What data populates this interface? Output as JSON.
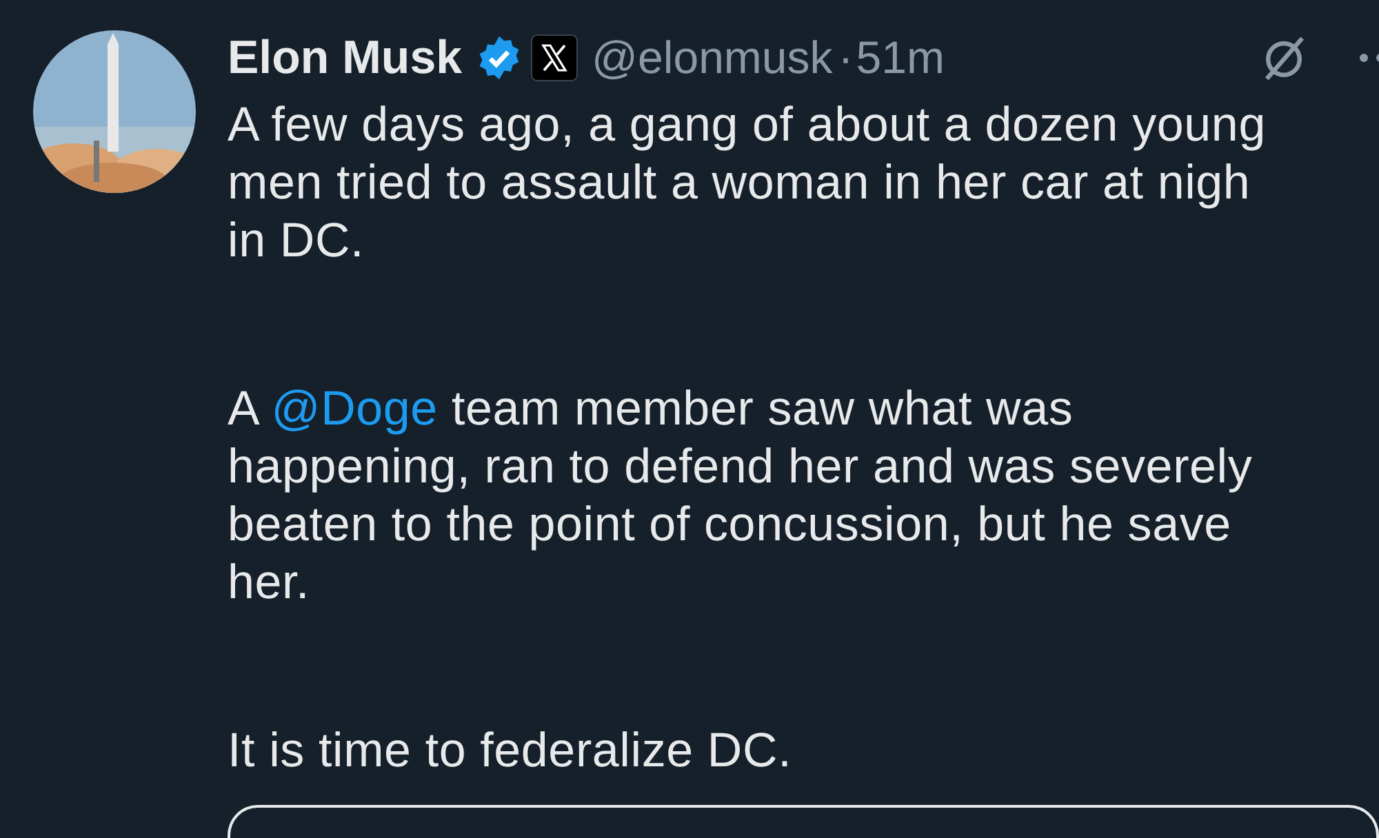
{
  "author": {
    "name": "Elon Musk",
    "verified": true,
    "handle": "@elonmusk",
    "separator": "·",
    "time": "51m"
  },
  "avatar": {
    "kind": "picture"
  },
  "paragraphs": [
    [
      [
        {
          "kind": "text",
          "text": "A few days ago, a gang of about a dozen young"
        }
      ],
      [
        {
          "kind": "text",
          "text": "men tried to assault a woman in her car at nigh"
        }
      ],
      [
        {
          "kind": "text",
          "text": "in DC."
        }
      ]
    ],
    [
      [
        {
          "kind": "text",
          "text": "A "
        },
        {
          "kind": "mention",
          "text": "@Doge"
        },
        {
          "kind": "text",
          "text": " team member saw what was"
        }
      ],
      [
        {
          "kind": "text",
          "text": "happening, ran to defend her and was severely"
        }
      ],
      [
        {
          "kind": "text",
          "text": "beaten to the point of concussion, but he save"
        }
      ],
      [
        {
          "kind": "text",
          "text": "her."
        }
      ]
    ],
    [
      [
        {
          "kind": "text",
          "text": "It is time to federalize DC."
        }
      ]
    ]
  ]
}
